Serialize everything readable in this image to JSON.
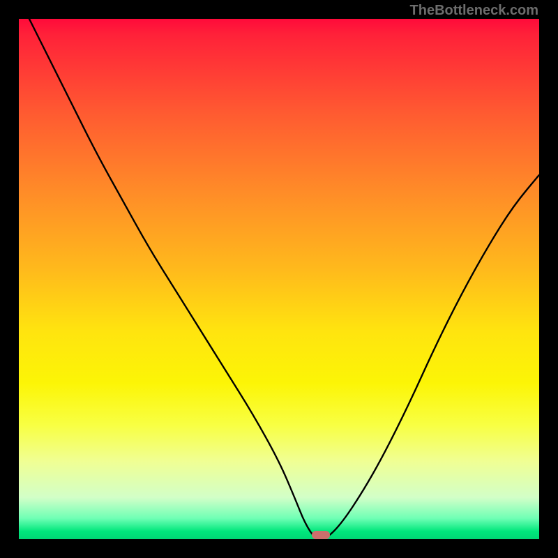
{
  "attribution": "TheBottleneck.com",
  "colors": {
    "page_bg": "#000000",
    "curve_stroke": "#000000",
    "marker_fill": "#cc6f6c",
    "attribution_text": "#6d6d6d"
  },
  "chart_data": {
    "type": "line",
    "title": "",
    "xlabel": "",
    "ylabel": "",
    "xlim": [
      0,
      100
    ],
    "ylim": [
      0,
      100
    ],
    "grid": false,
    "legend": false,
    "series": [
      {
        "name": "bottleneck-curve",
        "x": [
          2,
          5,
          10,
          15,
          20,
          25,
          30,
          35,
          40,
          45,
          50,
          53,
          55,
          57,
          59,
          62,
          66,
          70,
          75,
          80,
          85,
          90,
          95,
          100
        ],
        "values": [
          100,
          94,
          84,
          74,
          65,
          56,
          48,
          40,
          32,
          24,
          15,
          8,
          3,
          0,
          0,
          3,
          9,
          16,
          26,
          37,
          47,
          56,
          64,
          70
        ]
      }
    ],
    "marker": {
      "x": 58,
      "y": 0.8
    },
    "gradient_stops": [
      {
        "pos": 0,
        "color": "#ff0a3a"
      },
      {
        "pos": 0.18,
        "color": "#ff5a31"
      },
      {
        "pos": 0.33,
        "color": "#ff8b28"
      },
      {
        "pos": 0.48,
        "color": "#ffb91c"
      },
      {
        "pos": 0.6,
        "color": "#ffe40f"
      },
      {
        "pos": 0.78,
        "color": "#f8ff42"
      },
      {
        "pos": 0.92,
        "color": "#d2ffc8"
      },
      {
        "pos": 0.97,
        "color": "#6fffb5"
      },
      {
        "pos": 1.0,
        "color": "#00d775"
      }
    ]
  }
}
